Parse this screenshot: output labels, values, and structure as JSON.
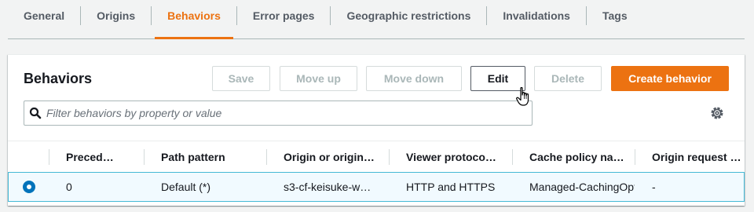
{
  "tabs": [
    {
      "label": "General"
    },
    {
      "label": "Origins"
    },
    {
      "label": "Behaviors",
      "active": true
    },
    {
      "label": "Error pages"
    },
    {
      "label": "Geographic restrictions"
    },
    {
      "label": "Invalidations"
    },
    {
      "label": "Tags"
    }
  ],
  "panel": {
    "title": "Behaviors",
    "buttons": {
      "save": "Save",
      "move_up": "Move up",
      "move_down": "Move down",
      "edit": "Edit",
      "delete": "Delete",
      "create": "Create behavior"
    },
    "search": {
      "placeholder": "Filter behaviors by property or value"
    }
  },
  "table": {
    "headers": [
      "Preced…",
      "Path pattern",
      "Origin or origin…",
      "Viewer protoco…",
      "Cache policy na…",
      "Origin request …"
    ],
    "rows": [
      {
        "selected": true,
        "cells": [
          "0",
          "Default (*)",
          "s3-cf-keisuke-w…",
          "HTTP and HTTPS",
          "Managed-CachingOpt",
          "-"
        ]
      }
    ]
  },
  "colors": {
    "accent": "#ec7211",
    "selected_row_border": "#44b9d6",
    "radio": "#0073bb"
  },
  "icons": [
    "search-icon",
    "gear-icon",
    "hand-cursor-icon"
  ]
}
